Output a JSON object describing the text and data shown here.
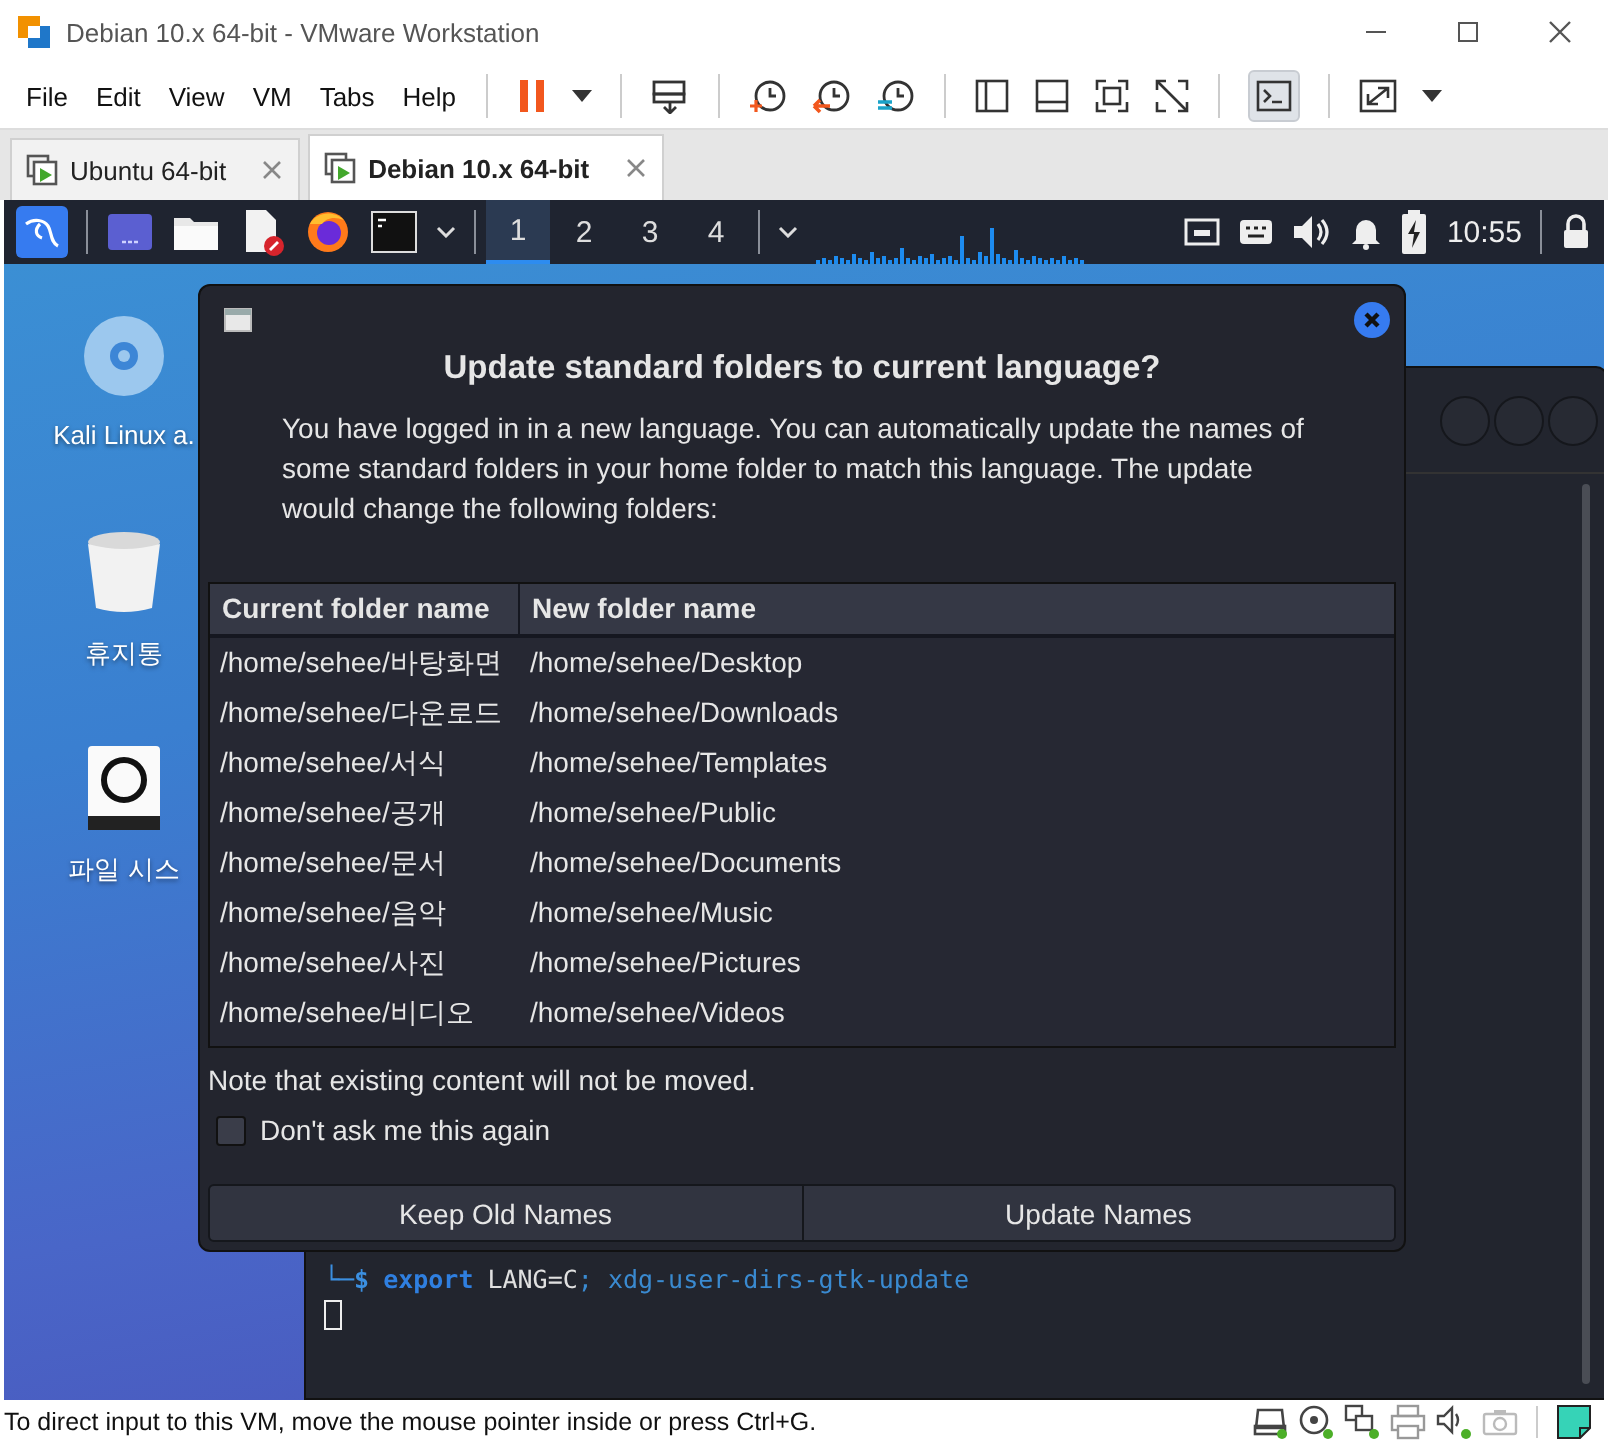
{
  "window": {
    "title": "Debian 10.x 64-bit - VMware Workstation"
  },
  "menu": [
    "File",
    "Edit",
    "View",
    "VM",
    "Tabs",
    "Help"
  ],
  "toolbar": {
    "console_view_pressed": true
  },
  "tabs": [
    {
      "label": "Ubuntu 64-bit",
      "selected": false
    },
    {
      "label": "Debian 10.x 64-bit",
      "selected": true
    }
  ],
  "panel": {
    "workspaces": [
      {
        "label": "1",
        "selected": true
      },
      {
        "label": "2",
        "selected": false
      },
      {
        "label": "3",
        "selected": false
      },
      {
        "label": "4",
        "selected": false
      }
    ],
    "clock": "10:55"
  },
  "desktop_icons": [
    {
      "label": "Kali Linux a.",
      "kind": "disc"
    },
    {
      "label": "휴지통",
      "kind": "trash"
    },
    {
      "label": "파일 시스",
      "kind": "drive"
    }
  ],
  "terminal": {
    "parts": [
      {
        "kind": "prompt",
        "text": "└─$"
      },
      {
        "kind": "keyword",
        "text": "export"
      },
      {
        "kind": "argument",
        "text": "LANG=C"
      },
      {
        "kind": "rest",
        "text": "; xdg-user-dirs-gtk-update"
      }
    ]
  },
  "dialog": {
    "title": "Update standard folders to current language?",
    "message": "You have logged in in a new language. You can automatically update the names of some standard folders in your home folder to match this language. The update would change the following folders:",
    "columns": [
      "Current folder name",
      "New folder name"
    ],
    "rows": [
      [
        "/home/sehee/바탕화면",
        "/home/sehee/Desktop"
      ],
      [
        "/home/sehee/다운로드",
        "/home/sehee/Downloads"
      ],
      [
        "/home/sehee/서식",
        "/home/sehee/Templates"
      ],
      [
        "/home/sehee/공개",
        "/home/sehee/Public"
      ],
      [
        "/home/sehee/문서",
        "/home/sehee/Documents"
      ],
      [
        "/home/sehee/음악",
        "/home/sehee/Music"
      ],
      [
        "/home/sehee/사진",
        "/home/sehee/Pictures"
      ],
      [
        "/home/sehee/비디오",
        "/home/sehee/Videos"
      ]
    ],
    "note": "Note that existing content will not be moved.",
    "checkbox": {
      "label": "Don't ask me this again",
      "checked": false
    },
    "buttons": [
      "Keep Old Names",
      "Update Names"
    ]
  },
  "status_bar": {
    "text": "To direct input to this VM, move the mouse pointer inside or press Ctrl+G."
  }
}
